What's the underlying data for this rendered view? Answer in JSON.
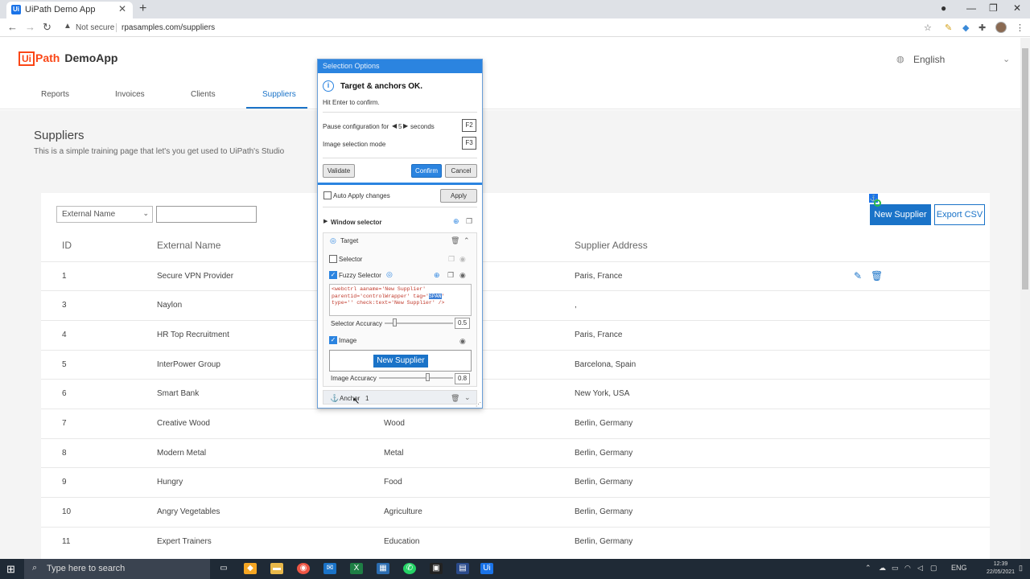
{
  "browser": {
    "tab_title": "UiPath Demo App",
    "tab_favicon": "Ui",
    "not_secure": "Not secure",
    "url": "rpasamples.com/suppliers"
  },
  "app": {
    "logo_ui": "Ui",
    "logo_path": "Path",
    "logo_demo": "DemoApp",
    "language": "English",
    "nav": [
      "Reports",
      "Invoices",
      "Clients",
      "Suppliers"
    ],
    "active_nav": "Suppliers",
    "page_title": "Suppliers",
    "page_subtitle": "This is a simple training page that let's you get used to UiPath's Studio",
    "filter_select": "External Name",
    "filter_value": "",
    "new_supplier": "New Supplier",
    "export_csv": "Export CSV",
    "columns": [
      "ID",
      "External Name",
      "Supplier Address"
    ],
    "rows": [
      {
        "id": "1",
        "name": "Secure VPN Provider",
        "industry": "",
        "address": "Paris, France"
      },
      {
        "id": "3",
        "name": "Naylon",
        "industry": "",
        "address": ","
      },
      {
        "id": "4",
        "name": "HR Top Recruitment",
        "industry": "",
        "address": "Paris, France"
      },
      {
        "id": "5",
        "name": "InterPower Group",
        "industry": "",
        "address": "Barcelona, Spain"
      },
      {
        "id": "6",
        "name": "Smart Bank",
        "industry": "",
        "address": "New York, USA"
      },
      {
        "id": "7",
        "name": "Creative Wood",
        "industry": "Wood",
        "address": "Berlin, Germany"
      },
      {
        "id": "8",
        "name": "Modern Metal",
        "industry": "Metal",
        "address": "Berlin, Germany"
      },
      {
        "id": "9",
        "name": "Hungry",
        "industry": "Food",
        "address": "Berlin, Germany"
      },
      {
        "id": "10",
        "name": "Angry Vegetables",
        "industry": "Agriculture",
        "address": "Berlin, Germany"
      },
      {
        "id": "11",
        "name": "Expert Trainers",
        "industry": "Education",
        "address": "Berlin, Germany"
      }
    ]
  },
  "dialog": {
    "title": "Selection Options",
    "status": "Target & anchors OK.",
    "hint": "Hit Enter to confirm.",
    "pause_label": "Pause configuration for",
    "pause_value": "5",
    "pause_unit": "seconds",
    "pause_key": "F2",
    "image_mode": "Image selection mode",
    "image_key": "F3",
    "validate": "Validate",
    "confirm": "Confirm",
    "cancel": "Cancel",
    "auto_apply": "Auto Apply changes",
    "apply": "Apply",
    "window_selector": "Window selector",
    "target": "Target",
    "selector": "Selector",
    "fuzzy_selector": "Fuzzy Selector",
    "code_line1": "<webctrl aaname='New Supplier'",
    "code_line2a": "parentid='controlWrapper' tag='",
    "code_line2b": "SPAN",
    "code_line2c": "'",
    "code_line3": "type='' check:text='New Supplier' />",
    "selector_accuracy": "Selector Accuracy",
    "selector_accuracy_value": "0.5",
    "image": "Image",
    "image_preview": "New Supplier",
    "image_accuracy": "Image Accuracy",
    "image_accuracy_value": "0.8",
    "anchor": "Anchor",
    "anchor_count": "1"
  },
  "taskbar": {
    "search": "Type here to search",
    "lang": "ENG",
    "time": "12:39",
    "date": "22/05/2021"
  },
  "colors": {
    "accent": "#1a73c8",
    "uipath_orange": "#fa4616",
    "dialog_blue": "#2b84e0"
  }
}
